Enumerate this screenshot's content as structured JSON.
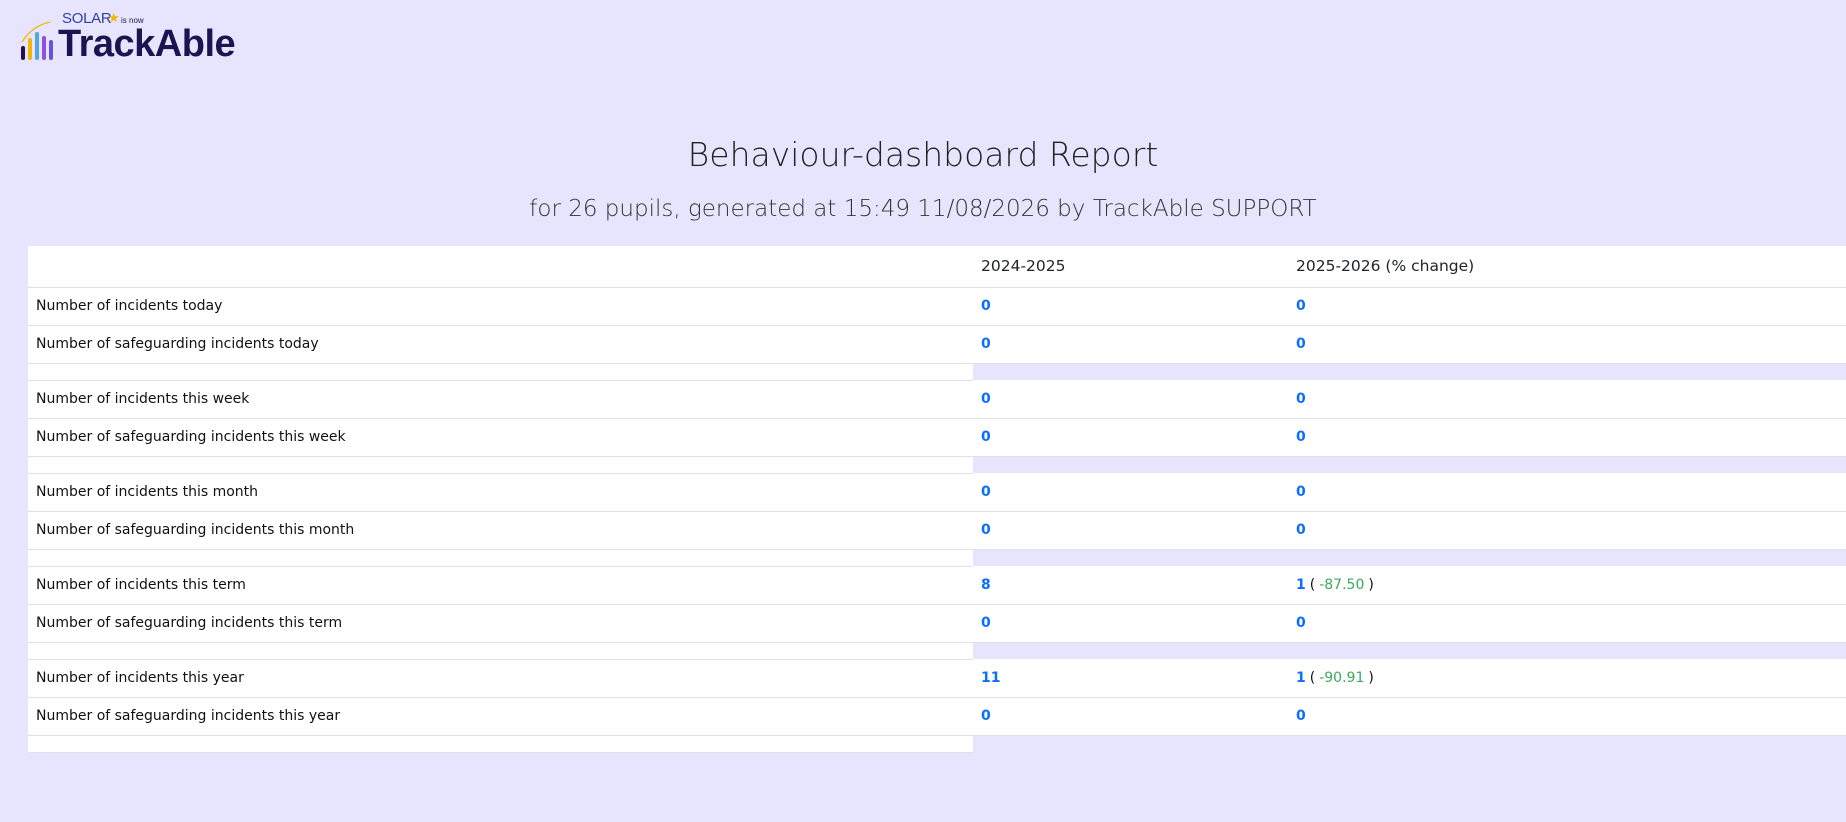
{
  "logo": {
    "solar_text": "SOLAR",
    "is_now_text": "is now",
    "brand_text": "TrackAble",
    "bar_colors": [
      "#2f3ea8",
      "#4fa7e6",
      "#f2b705",
      "#8f4fe0",
      "#1c1450"
    ]
  },
  "report": {
    "title": "Behaviour-dashboard Report",
    "subtitle": "for 26 pupils, generated at 15:49 11/08/2026 by TrackAble SUPPORT"
  },
  "table": {
    "headers": [
      "",
      "2024-2025",
      "2025-2026 (% change)"
    ],
    "rows": [
      {
        "label": "Number of incidents today",
        "prev": "0",
        "curr": "0",
        "change": ""
      },
      {
        "label": "Number of safeguarding incidents today",
        "prev": "0",
        "curr": "0",
        "change": ""
      },
      {
        "label": "Number of incidents this week",
        "prev": "0",
        "curr": "0",
        "change": ""
      },
      {
        "label": "Number of safeguarding incidents this week",
        "prev": "0",
        "curr": "0",
        "change": ""
      },
      {
        "label": "Number of incidents this month",
        "prev": "0",
        "curr": "0",
        "change": ""
      },
      {
        "label": "Number of safeguarding incidents this month",
        "prev": "0",
        "curr": "0",
        "change": ""
      },
      {
        "label": "Number of incidents this term",
        "prev": "8",
        "curr": "1",
        "change": "-87.50"
      },
      {
        "label": "Number of safeguarding incidents this term",
        "prev": "0",
        "curr": "0",
        "change": ""
      },
      {
        "label": "Number of incidents this year",
        "prev": "11",
        "curr": "1",
        "change": "-90.91"
      },
      {
        "label": "Number of safeguarding incidents this year",
        "prev": "0",
        "curr": "0",
        "change": ""
      }
    ],
    "paren_open": "(",
    "paren_close": ")"
  },
  "colors": {
    "page_background": "#e7e5fd",
    "link_value": "#0d6efd",
    "negative_change": "#3aab5c"
  }
}
